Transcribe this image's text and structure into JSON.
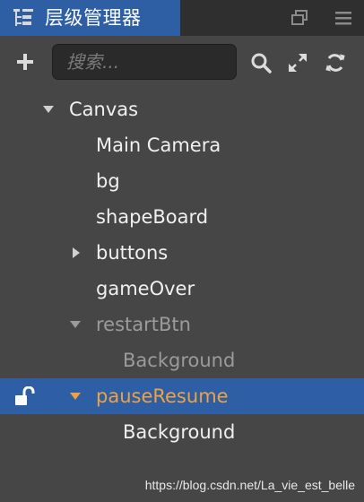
{
  "titlebar": {
    "title": "层级管理器",
    "icons": [
      "hierarchy-icon",
      "restore-window-icon",
      "menu-icon"
    ]
  },
  "toolbar": {
    "search_placeholder": "搜索...",
    "search_value": "",
    "icons": [
      "add-icon",
      "search-icon",
      "expand-icon",
      "refresh-icon"
    ]
  },
  "tree": {
    "nodes": [
      {
        "label": "Canvas",
        "expanded": true,
        "state": "normal"
      },
      {
        "label": "Main Camera",
        "state": "normal"
      },
      {
        "label": "bg",
        "state": "normal"
      },
      {
        "label": "shapeBoard",
        "state": "normal"
      },
      {
        "label": "buttons",
        "expanded": false,
        "state": "normal"
      },
      {
        "label": "gameOver",
        "state": "normal"
      },
      {
        "label": "restartBtn",
        "expanded": true,
        "state": "inactive"
      },
      {
        "label": "Background",
        "state": "inactive"
      },
      {
        "label": "pauseResume",
        "expanded": true,
        "state": "selected",
        "locked": false
      },
      {
        "label": "Background",
        "state": "normal"
      }
    ]
  },
  "watermark": "https://blog.csdn.net/La_vie_est_belle",
  "colors": {
    "accent": "#2e5ea3",
    "panel_bg": "#464646",
    "selected_text": "#f0a143",
    "inactive_text": "#9b9b9b"
  }
}
